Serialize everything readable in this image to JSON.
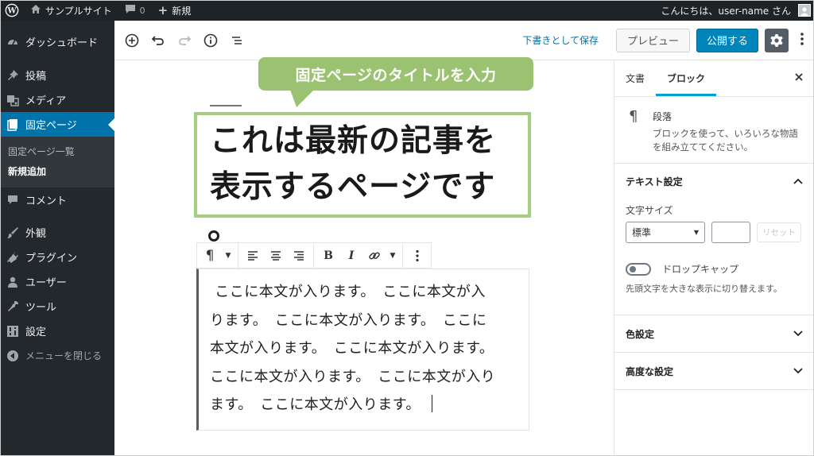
{
  "admin_bar": {
    "site_name": "サンプルサイト",
    "comments_count": "0",
    "new_label": "新規",
    "greeting": "こんにちは、user-name さん"
  },
  "admin_menu": {
    "dashboard": "ダッシュボード",
    "posts": "投稿",
    "media": "メディア",
    "pages": "固定ページ",
    "pages_sub": [
      "固定ページ一覧",
      "新規追加"
    ],
    "comments": "コメント",
    "appearance": "外観",
    "plugins": "プラグイン",
    "users": "ユーザー",
    "tools": "ツール",
    "settings": "設定",
    "collapse": "メニューを閉じる"
  },
  "header_toolbar": {
    "save_draft": "下書きとして保存",
    "preview": "プレビュー",
    "publish": "公開する"
  },
  "callout": {
    "text": "固定ページのタイトルを入力"
  },
  "post": {
    "title_line1": "これは最新の記事を",
    "title_line2": "表示するページです",
    "body_lines": [
      " ここに本文が入ります。　ここに本文が入",
      "ります。　ここに本文が入ります。　ここに",
      "本文が入ります。　ここに本文が入ります。",
      "ここに本文が入ります。　ここに本文が入り",
      "ます。　ここに本文が入ります。"
    ]
  },
  "sidebar": {
    "tab_document": "文書",
    "tab_block": "ブロック",
    "block_name": "段落",
    "block_desc_line1": "ブロックを使って、いろいろな物語",
    "block_desc_line2": "を組み立ててください。",
    "text_settings": {
      "title": "テキスト設定",
      "font_size_label": "文字サイズ",
      "font_size_value": "標準",
      "reset_label": "リセット",
      "drop_cap_label": "ドロップキャップ",
      "drop_cap_help": "先頭文字を大きな表示に切り替えます。"
    },
    "color_settings": "色設定",
    "advanced_settings": "高度な設定"
  },
  "colors": {
    "admin_bar_bg": "#1d2327",
    "menu_bg": "#23282d",
    "menu_active": "#0073aa",
    "publish_bg": "#0085ba",
    "callout_bg": "#9bc270",
    "title_border": "#a6ce82",
    "tab_underline": "#00a0d2"
  },
  "icons": {
    "wordpress": "wordpress-logo-icon",
    "home": "home-icon",
    "comment": "comment-bubble-icon",
    "plus": "plus-icon",
    "dashboard": "dashboard-gauge-icon",
    "pin": "pushpin-icon",
    "media": "media-icon",
    "page": "page-icon",
    "appearance": "paintbrush-icon",
    "plugins": "plug-icon",
    "users": "user-icon",
    "tools": "wrench-icon",
    "settings": "settings-icon",
    "collapse": "collapse-arrow-icon"
  }
}
